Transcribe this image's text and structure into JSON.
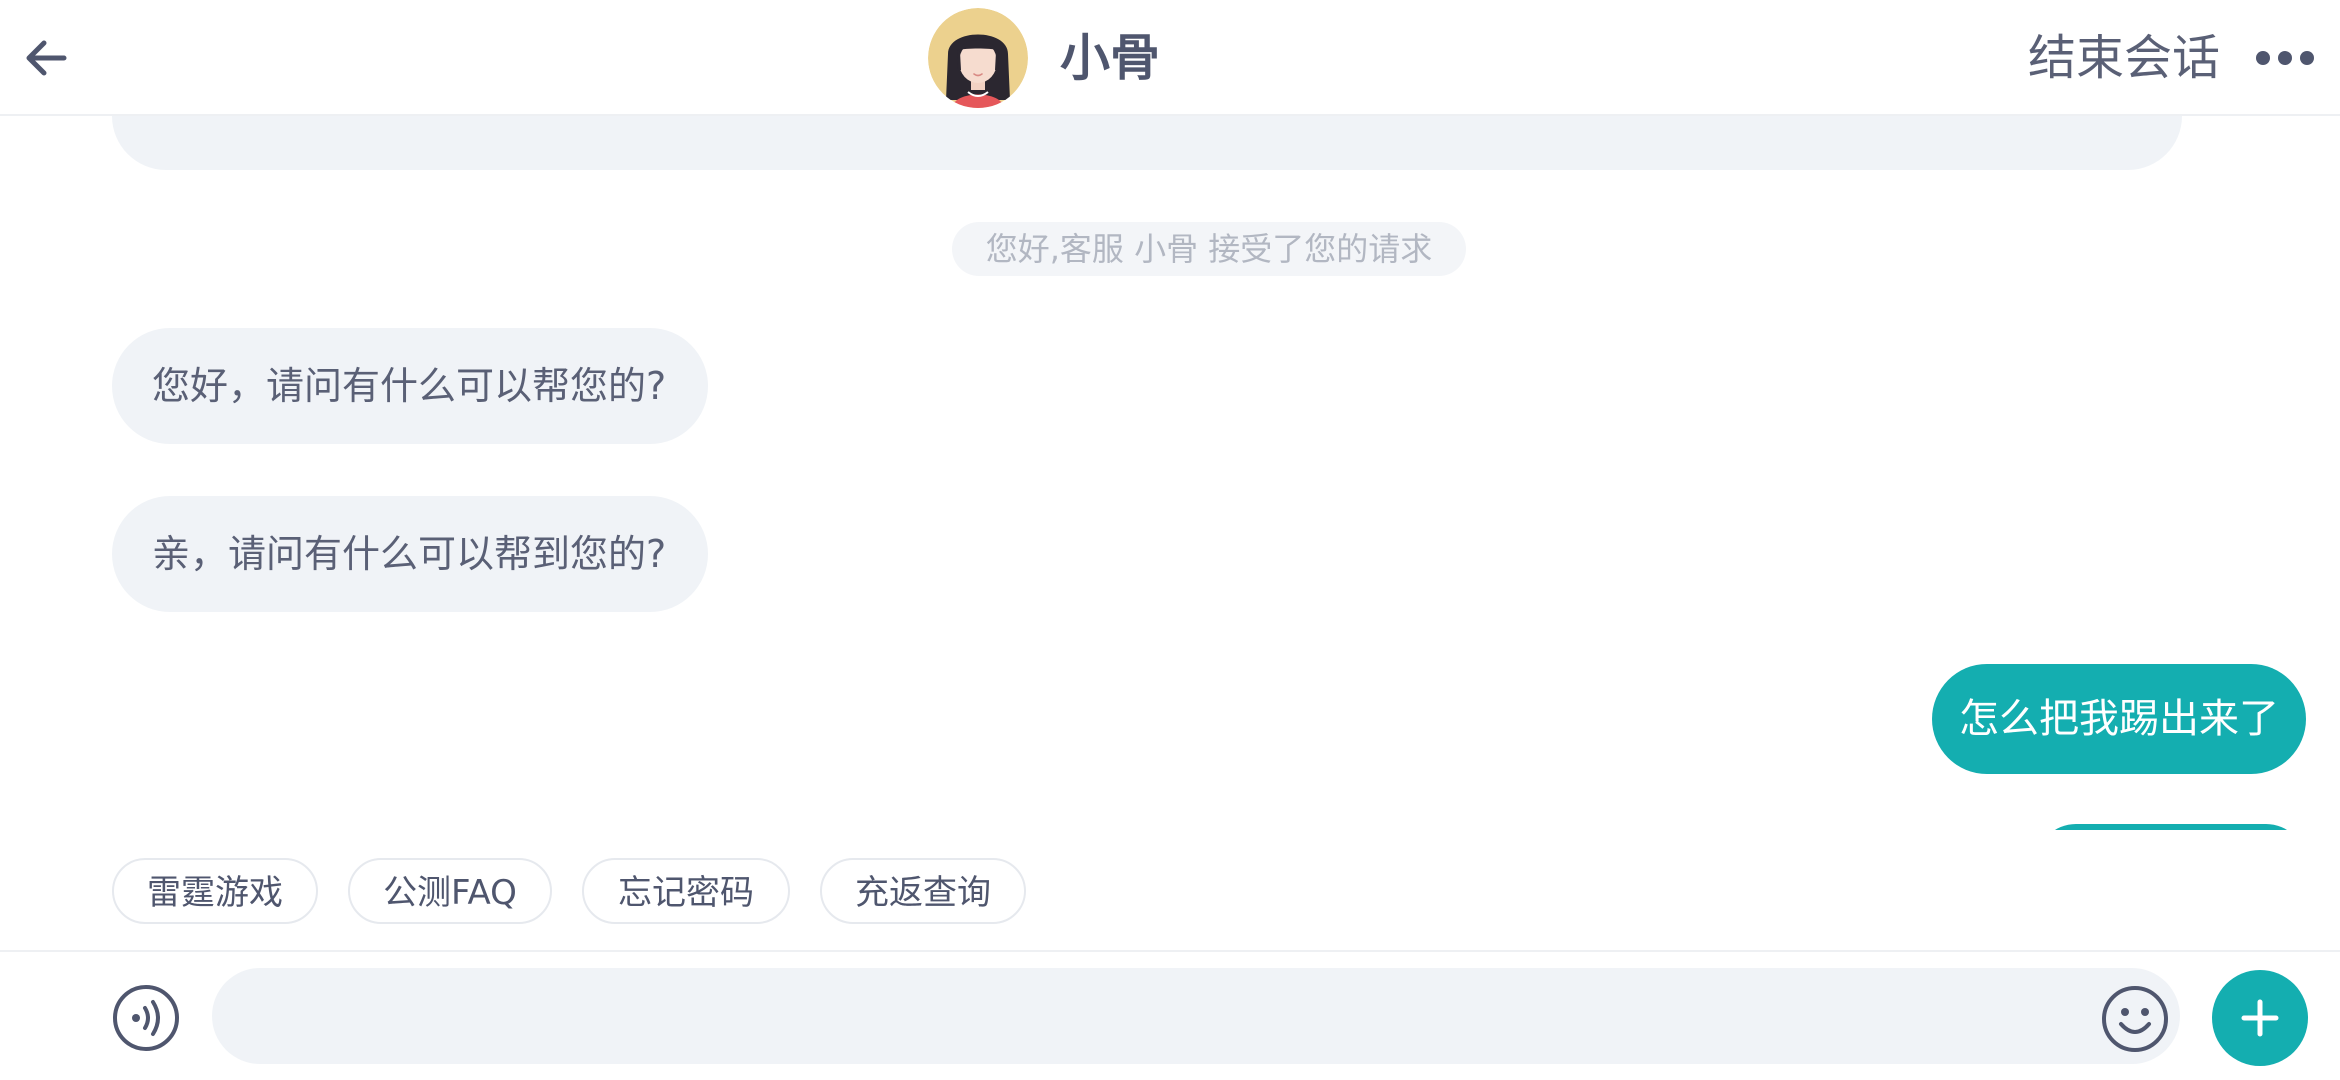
{
  "header": {
    "agent_name": "小骨",
    "end_session_label": "结束会话",
    "back_icon": "arrow-left-icon",
    "more_icon": "more-horizontal-icon",
    "avatar_icon": "agent-avatar"
  },
  "chat": {
    "system_notice": "您好,客服 小骨 接受了您的请求",
    "messages": [
      {
        "from": "agent",
        "text": "您好，请问有什么可以帮您的?"
      },
      {
        "from": "agent",
        "text": "亲，请问有什么可以帮到您的?"
      },
      {
        "from": "user",
        "text": "怎么把我踢出来了"
      }
    ]
  },
  "quick_replies": [
    "雷霆游戏",
    "公测FAQ",
    "忘记密码",
    "充返查询"
  ],
  "input": {
    "value": "",
    "placeholder": "",
    "voice_icon": "voice-icon",
    "emoji_icon": "emoji-icon",
    "plus_icon": "plus-icon"
  },
  "colors": {
    "accent": "#14aeb0",
    "text_primary": "#4f566e",
    "bubble_bg": "#f0f3f7",
    "notice_text": "#b2b7c2"
  }
}
